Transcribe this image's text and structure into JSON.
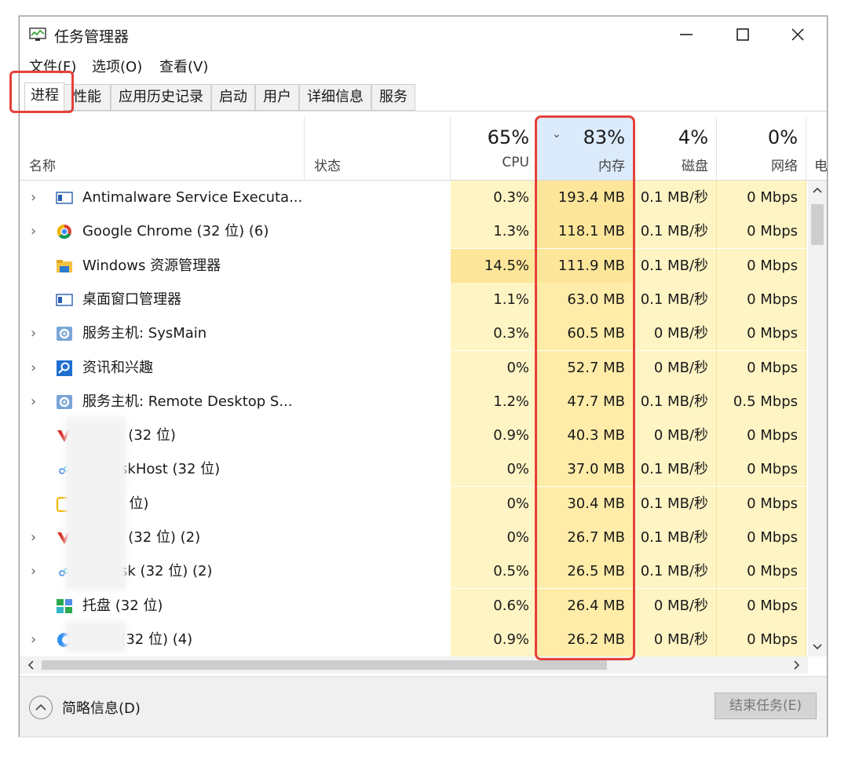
{
  "window": {
    "title": "任务管理器",
    "icon": "task-manager-icon",
    "controls": [
      "minimize-icon",
      "maximize-icon",
      "close-icon"
    ]
  },
  "menu": [
    "文件(F)",
    "选项(O)",
    "查看(V)"
  ],
  "tabs": [
    "进程",
    "性能",
    "应用历史记录",
    "启动",
    "用户",
    "详细信息",
    "服务"
  ],
  "active_tab": "进程",
  "columns": {
    "name": "名称",
    "status": "状态",
    "cpu": {
      "label": "CPU",
      "percent": "65%"
    },
    "memory": {
      "label": "内存",
      "percent": "83%"
    },
    "disk": {
      "label": "磁盘",
      "percent": "4%"
    },
    "network": {
      "label": "网络",
      "percent": "0%"
    },
    "power": "电"
  },
  "rows": [
    {
      "name": "Antimalware Service Executa...",
      "icon": "antimalware-service-icon",
      "expandable": true,
      "cpu": "0.3%",
      "memory": "193.4 MB",
      "disk": "0.1 MB/秒",
      "network": "0 Mbps"
    },
    {
      "name": "Google Chrome (32 位) (6)",
      "icon": "chrome-icon",
      "expandable": true,
      "cpu": "1.3%",
      "memory": "118.1 MB",
      "disk": "0.1 MB/秒",
      "network": "0 Mbps"
    },
    {
      "name": "Windows 资源管理器",
      "icon": "folder-icon",
      "expandable": false,
      "cpu": "14.5%",
      "memory": "111.9 MB",
      "disk": "0.1 MB/秒",
      "network": "0 Mbps"
    },
    {
      "name": "桌面窗口管理器",
      "icon": "window-manager-icon",
      "expandable": false,
      "cpu": "1.1%",
      "memory": "63.0 MB",
      "disk": "0.1 MB/秒",
      "network": "0 Mbps"
    },
    {
      "name": "服务主机: SysMain",
      "icon": "gear-icon",
      "expandable": true,
      "cpu": "0.3%",
      "memory": "60.5 MB",
      "disk": "0 MB/秒",
      "network": "0 Mbps"
    },
    {
      "name": "资讯和兴趣",
      "icon": "search-icon",
      "expandable": true,
      "cpu": "0%",
      "memory": "52.7 MB",
      "disk": "0 MB/秒",
      "network": "0 Mbps"
    },
    {
      "name": "服务主机: Remote Desktop S...",
      "icon": "gear-icon",
      "expandable": true,
      "cpu": "1.2%",
      "memory": "47.7 MB",
      "disk": "0.1 MB/秒",
      "network": "0.5 Mbps"
    },
    {
      "name": "Office (32 位)",
      "icon": "office-red-icon",
      "expandable": false,
      "cpu": "0.9%",
      "memory": "40.3 MB",
      "disk": "0 MB/秒",
      "network": "0 Mbps"
    },
    {
      "name": "NetdiskHost (32 位)",
      "icon": "netdisk-icon",
      "expandable": false,
      "cpu": "0%",
      "memory": "37.0 MB",
      "disk": "0.1 MB/秒",
      "network": "0 Mbps"
    },
    {
      "name": "身 (32 位)",
      "icon": "yellow-app-icon",
      "expandable": false,
      "cpu": "0%",
      "memory": "30.4 MB",
      "disk": "0.1 MB/秒",
      "network": "0 Mbps"
    },
    {
      "name": "Office (32 位) (2)",
      "icon": "office-red-icon",
      "expandable": true,
      "cpu": "0%",
      "memory": "26.7 MB",
      "disk": "0.1 MB/秒",
      "network": "0 Mbps"
    },
    {
      "name": "Netdisk (32 位) (2)",
      "icon": "netdisk-icon",
      "expandable": true,
      "cpu": "0.5%",
      "memory": "26.5 MB",
      "disk": "0.1 MB/秒",
      "network": "0 Mbps"
    },
    {
      "name": "托盘 (32 位)",
      "icon": "tray-icon",
      "expandable": false,
      "cpu": "0.6%",
      "memory": "26.4 MB",
      "disk": "0 MB/秒",
      "network": "0 Mbps"
    },
    {
      "name": "wser (32 位) (4)",
      "icon": "browser-icon",
      "expandable": true,
      "cpu": "0.9%",
      "memory": "26.2 MB",
      "disk": "0 MB/秒",
      "network": "0 Mbps"
    }
  ],
  "footer": {
    "fewer_details": "简略信息(D)",
    "end_task": "结束任务(E)"
  },
  "colors": {
    "cpu_high": "#fde69a",
    "cell_low": "#fff4c4",
    "cell_mid": "#ffeca8",
    "memory_header": "#dcebfb",
    "highlight_box": "#e5413a"
  }
}
